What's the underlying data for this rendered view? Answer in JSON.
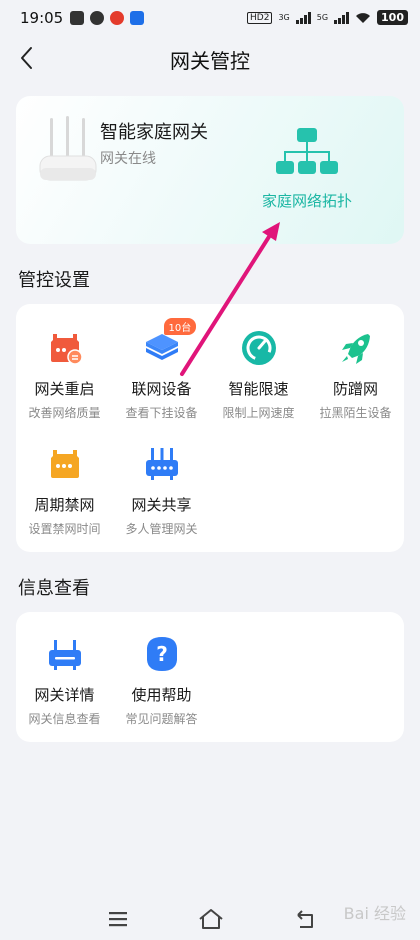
{
  "status_bar": {
    "time": "19:05",
    "network_hd": "HD2",
    "signal_1": "3G",
    "signal_2": "5G",
    "battery": "100"
  },
  "header": {
    "title": "网关管控",
    "back_icon": "chevron-left-icon"
  },
  "gateway_card": {
    "name": "智能家庭网关",
    "status": "网关在线",
    "topology_label": "家庭网络拓扑",
    "accent": "#1bb6a3"
  },
  "control_section": {
    "title": "管控设置",
    "items": [
      {
        "label": "网关重启",
        "sub": "改善网络质量",
        "icon": "router-restart-icon",
        "color": "#f05a3c"
      },
      {
        "label": "联网设备",
        "sub": "查看下挂设备",
        "icon": "layers-icon",
        "color": "#2f7cf6",
        "badge": "10台"
      },
      {
        "label": "智能限速",
        "sub": "限制上网速度",
        "icon": "speedometer-icon",
        "color": "#18b8a6"
      },
      {
        "label": "防蹭网",
        "sub": "拉黑陌生设备",
        "icon": "rocket-icon",
        "color": "#1cc28e"
      },
      {
        "label": "周期禁网",
        "sub": "设置禁网时间",
        "icon": "router-schedule-icon",
        "color": "#f5a623"
      },
      {
        "label": "网关共享",
        "sub": "多人管理网关",
        "icon": "router-share-icon",
        "color": "#2f7cf6"
      }
    ]
  },
  "info_section": {
    "title": "信息查看",
    "items": [
      {
        "label": "网关详情",
        "sub": "网关信息查看",
        "icon": "router-info-icon",
        "color": "#2f7cf6"
      },
      {
        "label": "使用帮助",
        "sub": "常见问题解答",
        "icon": "help-icon",
        "color": "#2f7cf6"
      }
    ]
  },
  "navbar": {
    "menu_icon": "menu-icon",
    "home_icon": "home-icon",
    "back_icon": "back-icon"
  },
  "watermark": "Bai 经验"
}
